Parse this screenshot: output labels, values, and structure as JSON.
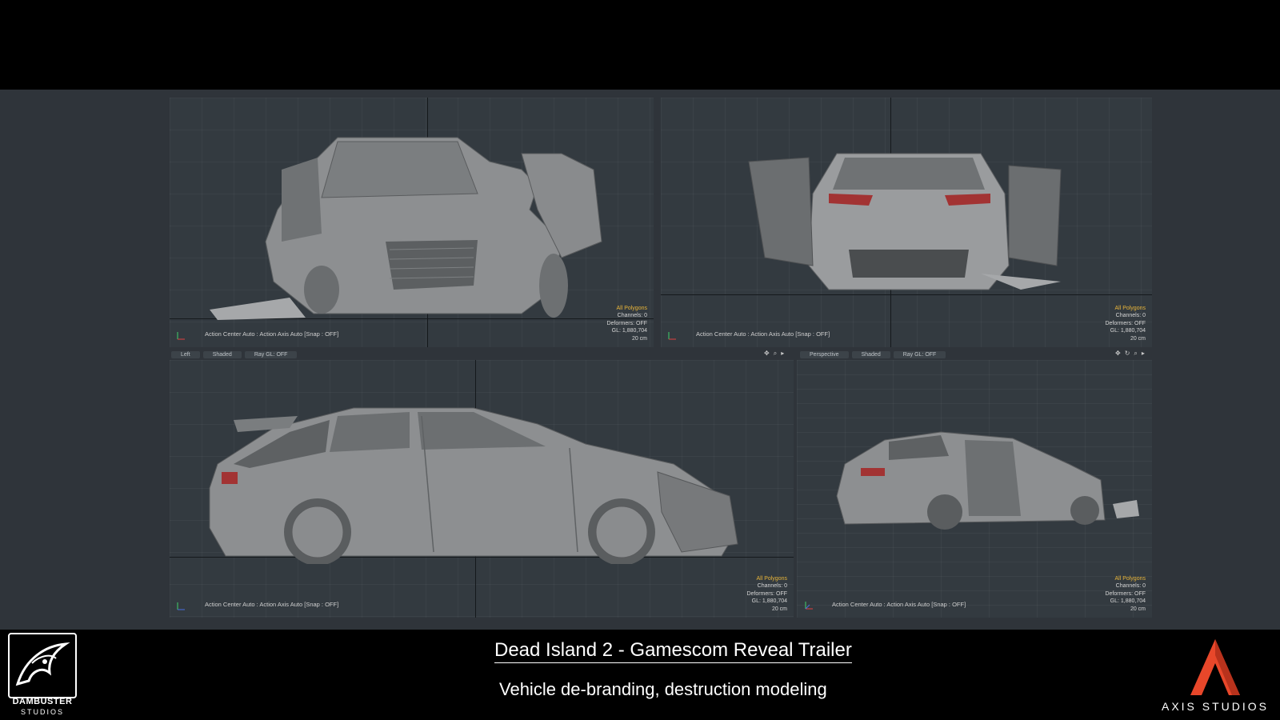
{
  "viewports": [
    {
      "id": "front",
      "hud": {
        "mode": "All Polygons",
        "channels": "Channels: 0",
        "deformers": "Deformers: OFF",
        "gl": "GL: 1,880,704",
        "scale": "20 cm"
      },
      "status": "Action Center Auto : Action Axis Auto  [Snap : OFF]"
    },
    {
      "id": "back",
      "hud": {
        "mode": "All Polygons",
        "channels": "Channels: 0",
        "deformers": "Deformers: OFF",
        "gl": "GL: 1,880,704",
        "scale": "20 cm"
      },
      "status": "Action Center Auto : Action Axis Auto  [Snap : OFF]"
    },
    {
      "id": "left",
      "tabs": [
        "Left",
        "Shaded",
        "Ray GL: OFF"
      ],
      "hud": {
        "mode": "All Polygons",
        "channels": "Channels: 0",
        "deformers": "Deformers: OFF",
        "gl": "GL: 1,880,704",
        "scale": "20 cm"
      },
      "status": "Action Center Auto : Action Axis Auto  [Snap : OFF]"
    },
    {
      "id": "perspective",
      "tabs": [
        "Perspective",
        "Shaded",
        "Ray GL: OFF"
      ],
      "hud": {
        "mode": "All Polygons",
        "channels": "Channels: 0",
        "deformers": "Deformers: OFF",
        "gl": "GL: 1,880,704",
        "scale": "20 cm"
      },
      "status": "Action Center Auto : Action Axis Auto  [Snap : OFF]"
    }
  ],
  "caption": {
    "title": "Dead Island 2 - Gamescom Reveal Trailer",
    "subtitle": "Vehicle de-branding, destruction modeling"
  },
  "logos": {
    "left": {
      "line1": "DAMBUSTER",
      "line2": "STUDIOS"
    },
    "right": {
      "text": "AXIS STUDIOS",
      "accent": "#e8472a"
    }
  },
  "colors": {
    "hud_highlight": "#e8b53a",
    "viewport_bg": "#333a40",
    "model": "#8d8f91"
  }
}
